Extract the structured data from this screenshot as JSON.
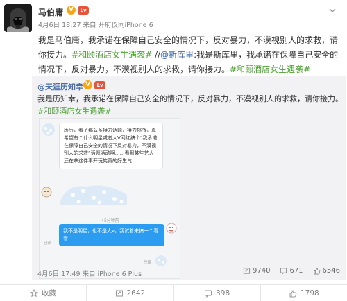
{
  "post": {
    "author": "马伯庸",
    "verified_badge": "V",
    "level_badge": "Lv",
    "meta": "4月6日 18:27 来自 开府仪同iPhone 6",
    "text_a": "我是马伯庸，我承诺在保障自己安全的情况下，反对暴力，不漠视别人的求救，请你接力。",
    "hashtag_a": "#和颐酒店女生遇袭#",
    "sep": " //",
    "mention": "@斯库里",
    "text_b": ":我是斯库里，我承诺在保障自己安全的情况下，反对暴力，不漠视别人的求救，请你接力。",
    "hashtag_b": "#和颐酒店女生遇袭#"
  },
  "repost": {
    "author": "@天涯历知幸",
    "verified_badge": "V",
    "level_badge": "Lv",
    "text": "我是历知幸，我承诺在保障自己安全的情况下，反对暴力，不漠视别人的求救，请你接力。",
    "hashtag": "#和颐酒店女生遇袭#",
    "meta": "4月6日 17:49 来自 iPhone 6 Plus",
    "stats": {
      "forwards": "9740",
      "comments": "671",
      "likes": "6546"
    }
  },
  "chat": {
    "bubble_left": "历历，看了那么多接力话题，接力挑战，真希望有个什么明星或者大V网红搞个“我承诺在保障自己安全的情况下反对暴力，不漠视别人的求救”话题活动啊……看到某些艺人还在拿这件事开玩笑真的好生气……",
    "time": "45分钟前",
    "bubble_right": "我不是明星，也不是大v，我试着来搞一个看看",
    "read": "已读",
    "read2": "已读"
  },
  "actions": {
    "favorite": "收藏",
    "forward": "2642",
    "comment": "398",
    "like": "1798"
  },
  "colors": {
    "hashtag": "#4aa12f",
    "link": "#4a6ea9",
    "bubble_right": "#2b9cf0"
  }
}
